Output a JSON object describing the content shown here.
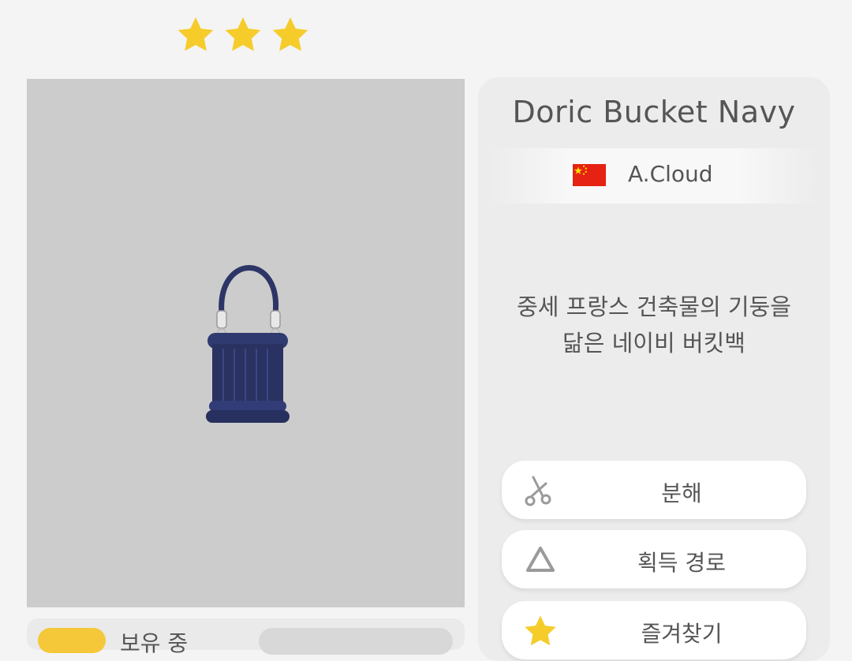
{
  "rating": {
    "stars": 3
  },
  "item": {
    "name": "Doric Bucket Navy",
    "maker": "A.Cloud",
    "maker_flag": "china-flag",
    "description_line1": "중세 프랑스 건축물의 기둥을",
    "description_line2": "닮은 네이비 버킷백"
  },
  "actions": {
    "disassemble_label": "분해",
    "source_label": "획득 경로",
    "favorite_label": "즐겨찾기"
  },
  "footer": {
    "owned_label": "보유 중"
  },
  "colors": {
    "star": "#f5cc2a",
    "bag": "#2c3566",
    "preview_bg": "#cccccc",
    "panel_bg": "#ececec",
    "flag_red": "#e52213",
    "flag_yellow": "#ffde00"
  }
}
